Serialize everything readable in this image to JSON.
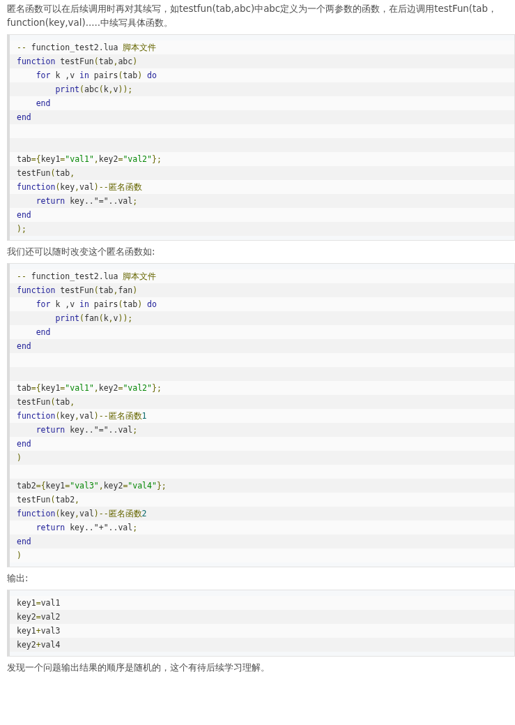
{
  "content": [
    {
      "kind": "paragraph",
      "text": "匿名函数可以在后续调用时再对其续写，如testfun(tab,abc)中abc定义为一个两参数的函数，在后边调用testFun(tab，function(key,val).....中续写具体函数。"
    },
    {
      "kind": "code",
      "lines": [
        {
          "kind": "code",
          "tokens": [
            {
              "text": "--",
              "kind": "com"
            },
            {
              "text": " function_test2.lua ",
              "kind": "pln"
            },
            {
              "text": "脚本文件",
              "kind": "com"
            }
          ]
        },
        {
          "kind": "code",
          "tokens": [
            {
              "text": "function",
              "kind": "kw"
            },
            {
              "text": " testFun",
              "kind": "pln"
            },
            {
              "text": "(",
              "kind": "pun"
            },
            {
              "text": "tab",
              "kind": "pln"
            },
            {
              "text": ",",
              "kind": "pun"
            },
            {
              "text": "abc",
              "kind": "pln"
            },
            {
              "text": ")",
              "kind": "pun"
            }
          ]
        },
        {
          "kind": "code",
          "tokens": [
            {
              "text": "    for",
              "kind": "kw"
            },
            {
              "text": " k ,v ",
              "kind": "pln"
            },
            {
              "text": "in",
              "kind": "kw"
            },
            {
              "text": " pairs",
              "kind": "pln"
            },
            {
              "text": "(",
              "kind": "pun"
            },
            {
              "text": "tab",
              "kind": "pln"
            },
            {
              "text": ")",
              "kind": "pun"
            },
            {
              "text": " do",
              "kind": "kw"
            }
          ]
        },
        {
          "kind": "code",
          "tokens": [
            {
              "text": "        print",
              "kind": "kw"
            },
            {
              "text": "(",
              "kind": "pun"
            },
            {
              "text": "abc",
              "kind": "pln"
            },
            {
              "text": "(",
              "kind": "pun"
            },
            {
              "text": "k",
              "kind": "pln"
            },
            {
              "text": ",",
              "kind": "pun"
            },
            {
              "text": "v",
              "kind": "pln"
            },
            {
              "text": "));",
              "kind": "pun"
            }
          ]
        },
        {
          "kind": "code",
          "tokens": [
            {
              "text": "    end",
              "kind": "kw"
            }
          ]
        },
        {
          "kind": "code",
          "tokens": [
            {
              "text": "end",
              "kind": "kw"
            }
          ]
        },
        {
          "kind": "blank"
        },
        {
          "kind": "blank"
        },
        {
          "kind": "code",
          "tokens": [
            {
              "text": "tab",
              "kind": "pln"
            },
            {
              "text": "={",
              "kind": "pun"
            },
            {
              "text": "key1",
              "kind": "pln"
            },
            {
              "text": "=",
              "kind": "pun"
            },
            {
              "text": "\"val1\"",
              "kind": "str"
            },
            {
              "text": ",",
              "kind": "pun"
            },
            {
              "text": "key2",
              "kind": "pln"
            },
            {
              "text": "=",
              "kind": "pun"
            },
            {
              "text": "\"val2\"",
              "kind": "str"
            },
            {
              "text": "};",
              "kind": "pun"
            }
          ]
        },
        {
          "kind": "code",
          "tokens": [
            {
              "text": "testFun",
              "kind": "pln"
            },
            {
              "text": "(",
              "kind": "pun"
            },
            {
              "text": "tab",
              "kind": "pln"
            },
            {
              "text": ",",
              "kind": "pun"
            }
          ]
        },
        {
          "kind": "code",
          "tokens": [
            {
              "text": "function",
              "kind": "kw"
            },
            {
              "text": "(",
              "kind": "pun"
            },
            {
              "text": "key",
              "kind": "pln"
            },
            {
              "text": ",",
              "kind": "pun"
            },
            {
              "text": "val",
              "kind": "pln"
            },
            {
              "text": ")--",
              "kind": "pun"
            },
            {
              "text": "匿名函数",
              "kind": "com"
            }
          ]
        },
        {
          "kind": "code",
          "tokens": [
            {
              "text": "    return",
              "kind": "kw"
            },
            {
              "text": " key..\"=\"..val",
              "kind": "pln"
            },
            {
              "text": ";",
              "kind": "pun"
            }
          ]
        },
        {
          "kind": "code",
          "tokens": [
            {
              "text": "end",
              "kind": "kw"
            }
          ]
        },
        {
          "kind": "code",
          "tokens": [
            {
              "text": ");",
              "kind": "pun"
            }
          ]
        }
      ]
    },
    {
      "kind": "paragraph",
      "text": "我们还可以随时改变这个匿名函数如:"
    },
    {
      "kind": "code",
      "lines": [
        {
          "kind": "code",
          "tokens": [
            {
              "text": "--",
              "kind": "com"
            },
            {
              "text": " function_test2.lua ",
              "kind": "pln"
            },
            {
              "text": "脚本文件",
              "kind": "com"
            }
          ]
        },
        {
          "kind": "code",
          "tokens": [
            {
              "text": "function",
              "kind": "kw"
            },
            {
              "text": " testFun",
              "kind": "pln"
            },
            {
              "text": "(",
              "kind": "pun"
            },
            {
              "text": "tab",
              "kind": "pln"
            },
            {
              "text": ",",
              "kind": "pun"
            },
            {
              "text": "fan",
              "kind": "pln"
            },
            {
              "text": ")",
              "kind": "pun"
            }
          ]
        },
        {
          "kind": "code",
          "tokens": [
            {
              "text": "    for",
              "kind": "kw"
            },
            {
              "text": " k ,v ",
              "kind": "pln"
            },
            {
              "text": "in",
              "kind": "kw"
            },
            {
              "text": " pairs",
              "kind": "pln"
            },
            {
              "text": "(",
              "kind": "pun"
            },
            {
              "text": "tab",
              "kind": "pln"
            },
            {
              "text": ")",
              "kind": "pun"
            },
            {
              "text": " do",
              "kind": "kw"
            }
          ]
        },
        {
          "kind": "code",
          "tokens": [
            {
              "text": "        print",
              "kind": "kw"
            },
            {
              "text": "(",
              "kind": "pun"
            },
            {
              "text": "fan",
              "kind": "pln"
            },
            {
              "text": "(",
              "kind": "pun"
            },
            {
              "text": "k",
              "kind": "pln"
            },
            {
              "text": ",",
              "kind": "pun"
            },
            {
              "text": "v",
              "kind": "pln"
            },
            {
              "text": "));",
              "kind": "pun"
            }
          ]
        },
        {
          "kind": "code",
          "tokens": [
            {
              "text": "    end",
              "kind": "kw"
            }
          ]
        },
        {
          "kind": "code",
          "tokens": [
            {
              "text": "end",
              "kind": "kw"
            }
          ]
        },
        {
          "kind": "blank"
        },
        {
          "kind": "blank"
        },
        {
          "kind": "code",
          "tokens": [
            {
              "text": "tab",
              "kind": "pln"
            },
            {
              "text": "={",
              "kind": "pun"
            },
            {
              "text": "key1",
              "kind": "pln"
            },
            {
              "text": "=",
              "kind": "pun"
            },
            {
              "text": "\"val1\"",
              "kind": "str"
            },
            {
              "text": ",",
              "kind": "pun"
            },
            {
              "text": "key2",
              "kind": "pln"
            },
            {
              "text": "=",
              "kind": "pun"
            },
            {
              "text": "\"val2\"",
              "kind": "str"
            },
            {
              "text": "};",
              "kind": "pun"
            }
          ]
        },
        {
          "kind": "code",
          "tokens": [
            {
              "text": "testFun",
              "kind": "pln"
            },
            {
              "text": "(",
              "kind": "pun"
            },
            {
              "text": "tab",
              "kind": "pln"
            },
            {
              "text": ",",
              "kind": "pun"
            }
          ]
        },
        {
          "kind": "code",
          "tokens": [
            {
              "text": "function",
              "kind": "kw"
            },
            {
              "text": "(",
              "kind": "pun"
            },
            {
              "text": "key",
              "kind": "pln"
            },
            {
              "text": ",",
              "kind": "pun"
            },
            {
              "text": "val",
              "kind": "pln"
            },
            {
              "text": ")--",
              "kind": "pun"
            },
            {
              "text": "匿名函数",
              "kind": "com"
            },
            {
              "text": "1",
              "kind": "lit"
            }
          ]
        },
        {
          "kind": "code",
          "tokens": [
            {
              "text": "    return",
              "kind": "kw"
            },
            {
              "text": " key..\"=\"..val",
              "kind": "pln"
            },
            {
              "text": ";",
              "kind": "pun"
            }
          ]
        },
        {
          "kind": "code",
          "tokens": [
            {
              "text": "end",
              "kind": "kw"
            }
          ]
        },
        {
          "kind": "code",
          "tokens": [
            {
              "text": ")",
              "kind": "pun"
            }
          ]
        },
        {
          "kind": "blank"
        },
        {
          "kind": "code",
          "tokens": [
            {
              "text": "tab2",
              "kind": "pln"
            },
            {
              "text": "={",
              "kind": "pun"
            },
            {
              "text": "key1",
              "kind": "pln"
            },
            {
              "text": "=",
              "kind": "pun"
            },
            {
              "text": "\"val3\"",
              "kind": "str"
            },
            {
              "text": ",",
              "kind": "pun"
            },
            {
              "text": "key2",
              "kind": "pln"
            },
            {
              "text": "=",
              "kind": "pun"
            },
            {
              "text": "\"val4\"",
              "kind": "str"
            },
            {
              "text": "};",
              "kind": "pun"
            }
          ]
        },
        {
          "kind": "code",
          "tokens": [
            {
              "text": "testFun",
              "kind": "pln"
            },
            {
              "text": "(",
              "kind": "pun"
            },
            {
              "text": "tab2",
              "kind": "pln"
            },
            {
              "text": ",",
              "kind": "pun"
            }
          ]
        },
        {
          "kind": "code",
          "tokens": [
            {
              "text": "function",
              "kind": "kw"
            },
            {
              "text": "(",
              "kind": "pun"
            },
            {
              "text": "key",
              "kind": "pln"
            },
            {
              "text": ",",
              "kind": "pun"
            },
            {
              "text": "val",
              "kind": "pln"
            },
            {
              "text": ")--",
              "kind": "pun"
            },
            {
              "text": "匿名函数",
              "kind": "com"
            },
            {
              "text": "2",
              "kind": "lit"
            }
          ]
        },
        {
          "kind": "code",
          "tokens": [
            {
              "text": "    return",
              "kind": "kw"
            },
            {
              "text": " key..\"+\"..val",
              "kind": "pln"
            },
            {
              "text": ";",
              "kind": "pun"
            }
          ]
        },
        {
          "kind": "code",
          "tokens": [
            {
              "text": "end",
              "kind": "kw"
            }
          ]
        },
        {
          "kind": "code",
          "tokens": [
            {
              "text": ")",
              "kind": "pun"
            }
          ]
        }
      ]
    },
    {
      "kind": "paragraph",
      "text": "输出:"
    },
    {
      "kind": "code",
      "lines": [
        {
          "kind": "code",
          "tokens": [
            {
              "text": "key1",
              "kind": "pln"
            },
            {
              "text": "=",
              "kind": "pun"
            },
            {
              "text": "val1",
              "kind": "pln"
            }
          ]
        },
        {
          "kind": "code",
          "tokens": [
            {
              "text": "key2",
              "kind": "pln"
            },
            {
              "text": "=",
              "kind": "pun"
            },
            {
              "text": "val2",
              "kind": "pln"
            }
          ]
        },
        {
          "kind": "code",
          "tokens": [
            {
              "text": "key1",
              "kind": "pln"
            },
            {
              "text": "+",
              "kind": "pun"
            },
            {
              "text": "val3",
              "kind": "pln"
            }
          ]
        },
        {
          "kind": "code",
          "tokens": [
            {
              "text": "key2",
              "kind": "pln"
            },
            {
              "text": "+",
              "kind": "pun"
            },
            {
              "text": "val4",
              "kind": "pln"
            }
          ]
        }
      ]
    },
    {
      "kind": "paragraph",
      "text": "发现一个问题输出结果的顺序是随机的，这个有待后续学习理解。"
    }
  ]
}
